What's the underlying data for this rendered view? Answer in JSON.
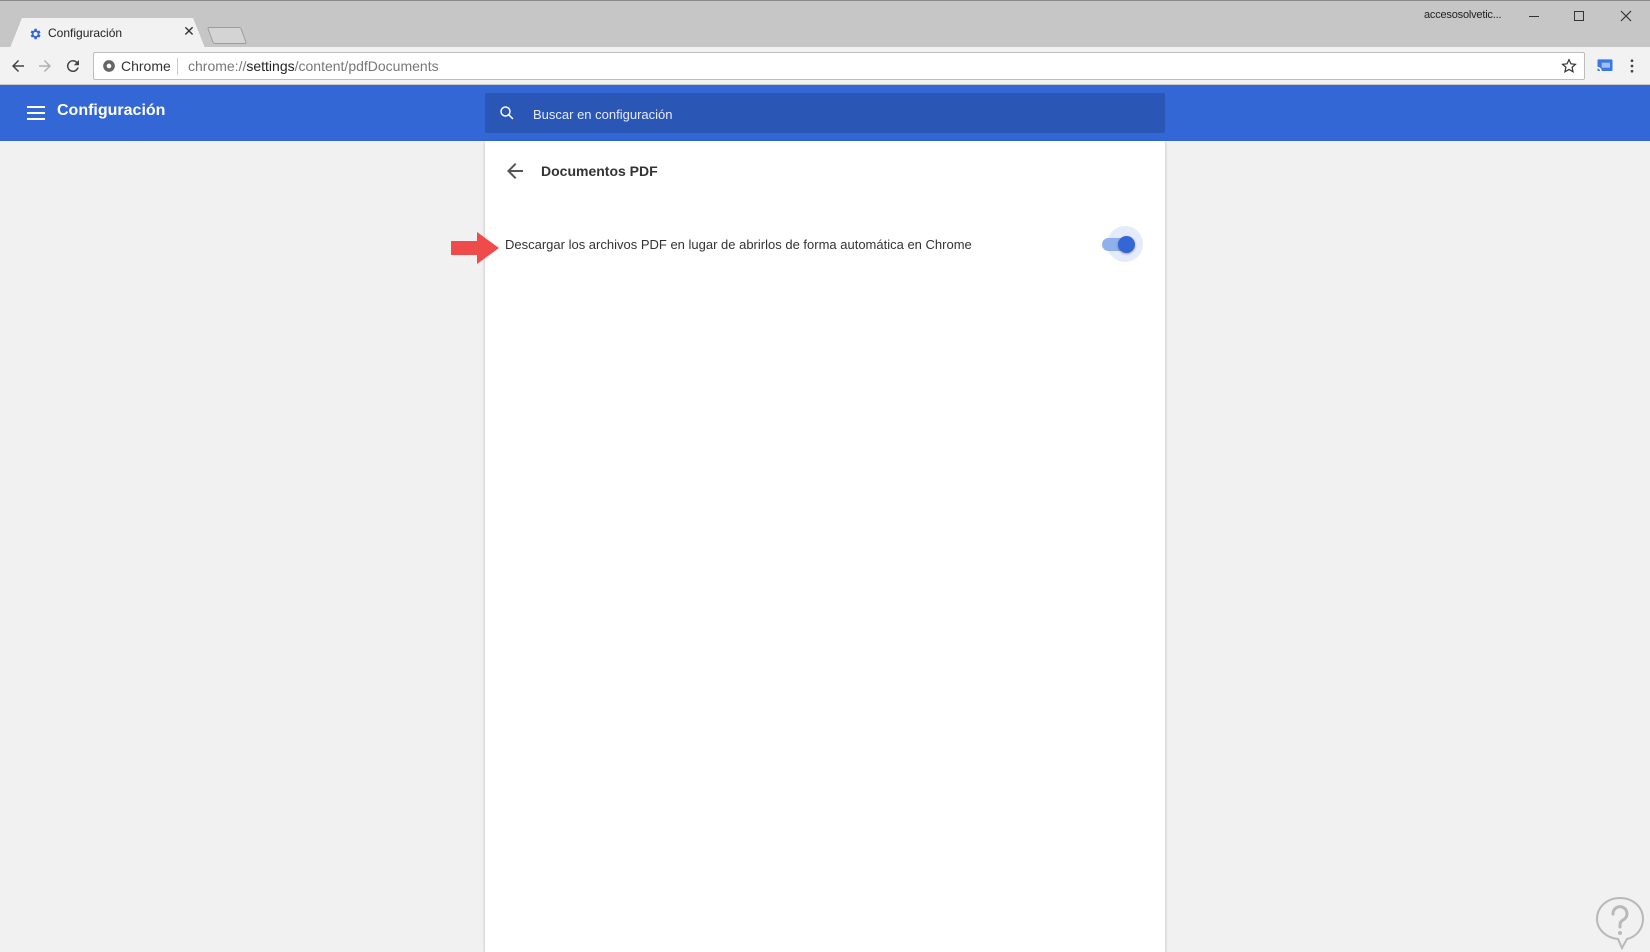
{
  "window": {
    "profile_name": "accesosolvetic...",
    "controls": [
      "minimize",
      "maximize",
      "close"
    ]
  },
  "tabs": [
    {
      "title": "Configuración",
      "icon": "gear-icon",
      "active": true
    }
  ],
  "toolbar": {
    "security_chip": "Chrome",
    "url_scheme": "chrome://",
    "url_host": "settings",
    "url_path": "/content/pdfDocuments"
  },
  "header": {
    "title": "Configuración",
    "search_placeholder": "Buscar en configuración"
  },
  "subpage": {
    "title": "Documentos PDF",
    "setting_label": "Descargar los archivos PDF en lugar de abrirlos de forma automática en Chrome",
    "toggle_checked": true
  },
  "colors": {
    "accent": "#3367d6",
    "search_bg": "#2a56b5",
    "annotation_arrow": "#ef4b4b"
  },
  "icons": [
    "gear-icon",
    "close-icon",
    "back-arrow-icon",
    "forward-arrow-icon",
    "reload-icon",
    "secure-icon",
    "star-icon",
    "cast-icon",
    "more-vert-icon",
    "hamburger-menu-icon",
    "search-icon",
    "arrow-back-icon"
  ]
}
